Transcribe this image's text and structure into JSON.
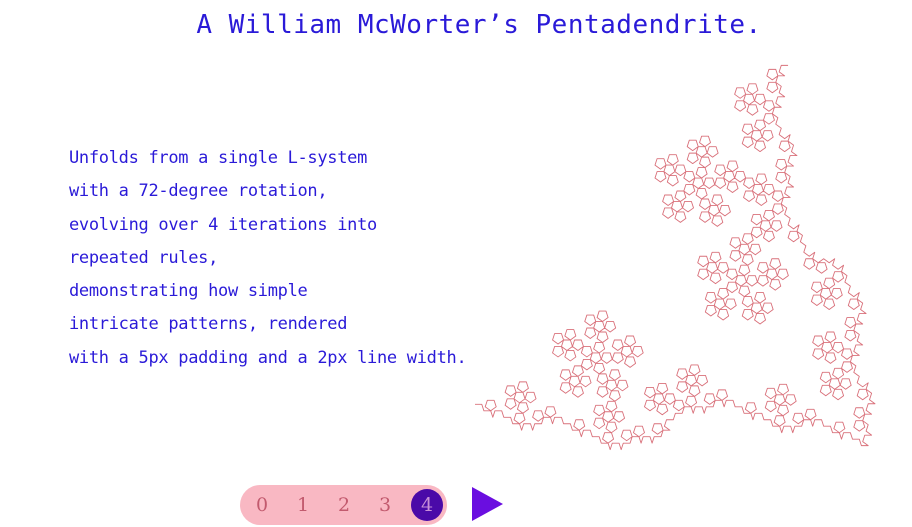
{
  "title": "A William McWorter’s Pentadendrite.",
  "description": [
    "Unfolds from a single L-system",
    "with a 72-degree rotation,",
    "evolving over 4 iterations into",
    "repeated rules,",
    "demonstrating how simple",
    "intricate patterns, rendered",
    "with a 5px padding and a 2px line width."
  ],
  "controls": {
    "iterations": [
      "0",
      "1",
      "2",
      "3",
      "4"
    ],
    "active_iteration": "4",
    "play_icon": "play-icon"
  },
  "colors": {
    "text": "#2a1ad8",
    "fractal_stroke": "#d9707a",
    "controls_bg": "#f9b8c3",
    "active_bg": "#4a0aa8",
    "play": "#6a0ee0"
  }
}
